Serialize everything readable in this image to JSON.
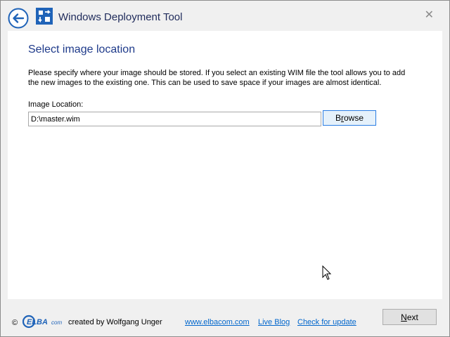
{
  "window": {
    "title": "Windows Deployment Tool",
    "close_glyph": "✕"
  },
  "page": {
    "heading": "Select image location",
    "description": "Please specify where your image should be stored. If you select an existing WIM file the tool allows you to add the new images to the existing one. This can be used to save space if your images are almost identical.",
    "image_location_label": "Image Location:",
    "image_location_value": "D:\\master.wim",
    "browse_label": "Browse",
    "browse_mnemonic": "r"
  },
  "footer": {
    "copyright": "©",
    "logo_text": "ELBA",
    "logo_suffix": "com",
    "created_by": "created by Wolfgang Unger",
    "links": [
      "www.elbacom.com",
      "Live Blog",
      "Check for update"
    ],
    "next_label": "Next",
    "next_mnemonic": "N"
  },
  "colors": {
    "accent": "#1e3a8a",
    "link": "#0066cc",
    "logo_blue": "#1f63b8"
  },
  "icons": [
    "back-arrow-icon",
    "deployment-app-icon",
    "close-icon",
    "mouse-cursor-icon"
  ]
}
